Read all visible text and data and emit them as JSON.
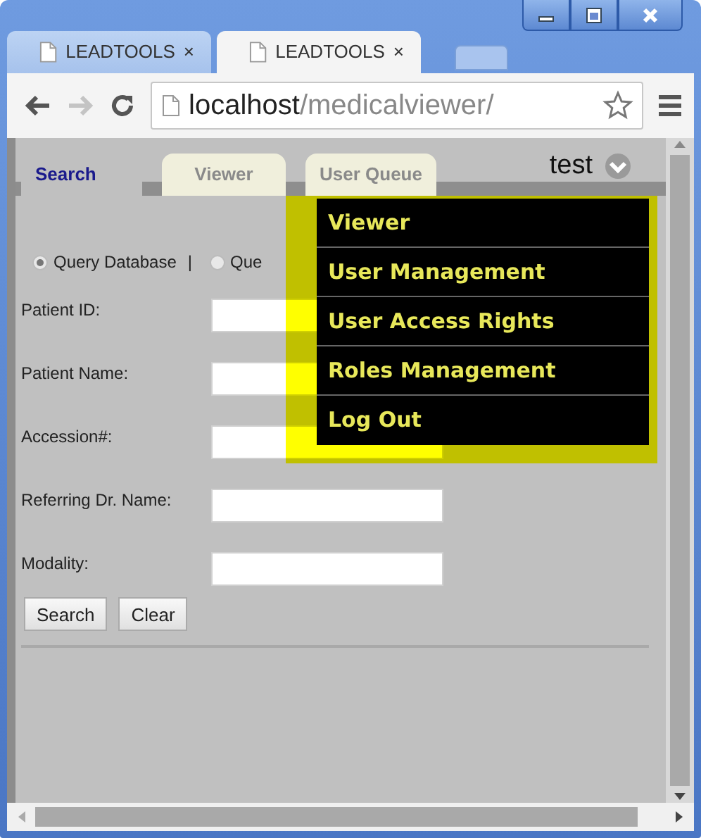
{
  "browser": {
    "tabs": [
      {
        "title": "LEADTOOLS",
        "close": "×",
        "selected": false
      },
      {
        "title": "LEADTOOLS",
        "close": "×",
        "selected": true
      }
    ],
    "address_bar": {
      "host": "localhost",
      "path": "/medicalviewer/"
    },
    "forward_disabled": true
  },
  "app": {
    "tabs": [
      {
        "label": "Search",
        "selected": true
      },
      {
        "label": "Viewer",
        "selected": false
      },
      {
        "label": "User Queue",
        "selected": false
      }
    ],
    "user": "test",
    "user_menu": {
      "expanded": true,
      "items": [
        "Viewer",
        "User Management",
        "User Access Rights",
        "Roles Management",
        "Log Out"
      ]
    },
    "query_options": [
      {
        "label": "Query Database",
        "selected": true
      },
      {
        "label": "Que",
        "selected": false
      }
    ],
    "query_separator": "|",
    "fields": [
      {
        "label": "Patient ID:"
      },
      {
        "label": "Patient Name:"
      },
      {
        "label": "Accession#:"
      },
      {
        "label": "Referring Dr. Name:"
      },
      {
        "label": "Modality:"
      }
    ],
    "buttons": [
      "Search",
      "Clear"
    ]
  }
}
